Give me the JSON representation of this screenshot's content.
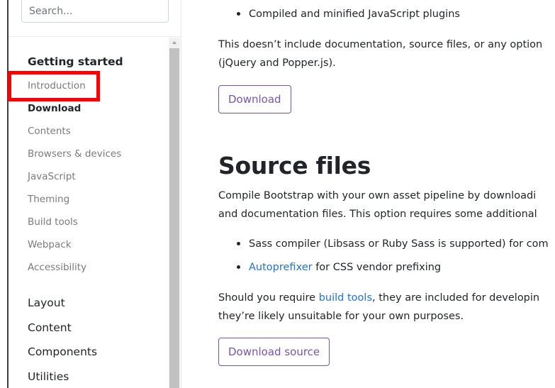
{
  "sidebar": {
    "search": {
      "placeholder": "Search..."
    },
    "getting_started": {
      "title": "Getting started",
      "items": [
        "Introduction",
        "Download",
        "Contents",
        "Browsers & devices",
        "JavaScript",
        "Theming",
        "Build tools",
        "Webpack",
        "Accessibility"
      ],
      "active": "Download"
    },
    "groups": [
      "Layout",
      "Content",
      "Components",
      "Utilities"
    ]
  },
  "main": {
    "top_bullet": "Compiled and minified JavaScript plugins",
    "para1_line1": "This doesn’t include documentation, source files, or any option",
    "para1_line2": "(jQuery and Popper.js).",
    "download_button": "Download",
    "section_heading": "Source files",
    "para2_line1": "Compile Bootstrap with your own asset pipeline by downloadi",
    "para2_line2": "and documentation files. This option requires some additional",
    "bullets": [
      {
        "text": "Sass compiler (Libsass or Ruby Sass is supported) for com"
      },
      {
        "link": "Autoprefixer",
        "text": " for CSS vendor prefixing"
      }
    ],
    "para3_prefix": "Should you require ",
    "para3_link": "build tools",
    "para3_suffix": ", they are included for developin",
    "para3_line2": "they’re likely unsuitable for your own purposes.",
    "download_source_button": "Download source"
  },
  "colors": {
    "accent": "#7952b3",
    "link": "#1a73e8",
    "highlight": "#ff0000"
  }
}
